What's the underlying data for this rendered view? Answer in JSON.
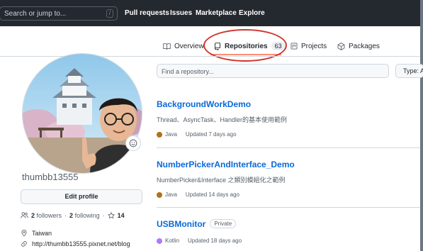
{
  "header": {
    "search_placeholder": "Search or jump to...",
    "search_shortcut": "/",
    "nav": [
      "Pull requests",
      "Issues",
      "Marketplace",
      "Explore"
    ]
  },
  "tabs": [
    {
      "label": "Overview",
      "icon": "book-open-icon"
    },
    {
      "label": "Repositories",
      "count": "63",
      "icon": "repo-icon",
      "active": true
    },
    {
      "label": "Projects",
      "icon": "project-icon"
    },
    {
      "label": "Packages",
      "icon": "package-icon"
    }
  ],
  "profile": {
    "username": "thumbb13555",
    "edit_label": "Edit profile",
    "followers_count": "2",
    "followers_label": "followers",
    "following_count": "2",
    "following_label": "following",
    "stars": "14",
    "location": "Taiwan",
    "website": "http://thumbb13555.pixnet.net/blog"
  },
  "repo_search": {
    "placeholder": "Find a repository...",
    "type_label": "Type: All"
  },
  "repos": [
    {
      "name": "BackgroundWorkDemo",
      "description": "Thread、AsyncTask、Handler的基本使用範例",
      "language": "Java",
      "language_color": "#b07219",
      "updated": "Updated 7 days ago"
    },
    {
      "name": "NumberPickerAndInterface_Demo",
      "description": "NumberPicker&Interface 之類別模組化之範例",
      "language": "Java",
      "language_color": "#b07219",
      "updated": "Updated 14 days ago"
    },
    {
      "name": "USBMonitor",
      "badge": "Private",
      "language": "Kotlin",
      "language_color": "#A97BFF",
      "updated": "Updated 18 days ago"
    }
  ],
  "colors": {
    "header_bg": "#24292f",
    "link": "#0969da",
    "annotation": "#d0342c",
    "tab_underline": "#fd8c73"
  }
}
